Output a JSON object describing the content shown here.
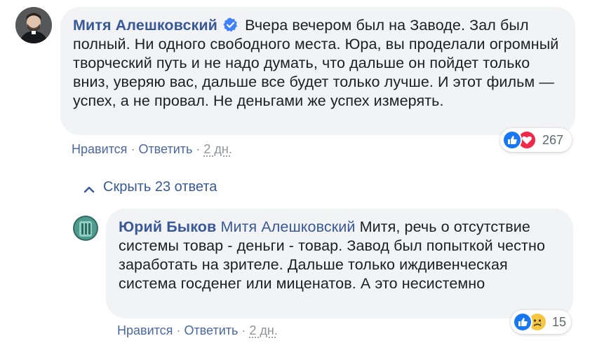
{
  "colors": {
    "link": "#385898",
    "bubble_bg": "#f2f3f5",
    "meta": "#90949c",
    "like_blue": "#1877f2",
    "love_red": "#f0284a",
    "sad_yellow": "#f7c744"
  },
  "comments": [
    {
      "author": "Митя Алешковский",
      "verified": true,
      "verified_icon": "verified-badge-icon",
      "text": "Вчера вечером был на Заводе. Зал был полный. Ни одного свободного места. Юра, вы проделали огромный творческий путь и не надо думать, что дальше он пойдет только вниз, уверяю вас, дальше все будет только лучше. И этот фильм — успех, а не провал. Не деньгами же успех измерять.",
      "like_label": "Нравится",
      "reply_label": "Ответить",
      "time": "2 дн.",
      "reactions": {
        "icons": [
          "like-icon",
          "love-icon"
        ],
        "count": "267"
      }
    }
  ],
  "replies_toggle": {
    "icon": "chevron-up-icon",
    "label": "Скрыть 23 ответа"
  },
  "replies": [
    {
      "author": "Юрий Быков",
      "tagged": "Митя Алешковский",
      "text": "Митя, речь о отсутствие системы товар - деньги - товар. Завод был попыткой честно заработать на зрителе. Дальше только иждивенческая система госденег или миценатов. А это несистемно",
      "like_label": "Нравится",
      "reply_label": "Ответить",
      "time": "2 дн.",
      "reactions": {
        "icons": [
          "like-icon",
          "sad-icon"
        ],
        "count": "15"
      }
    }
  ]
}
